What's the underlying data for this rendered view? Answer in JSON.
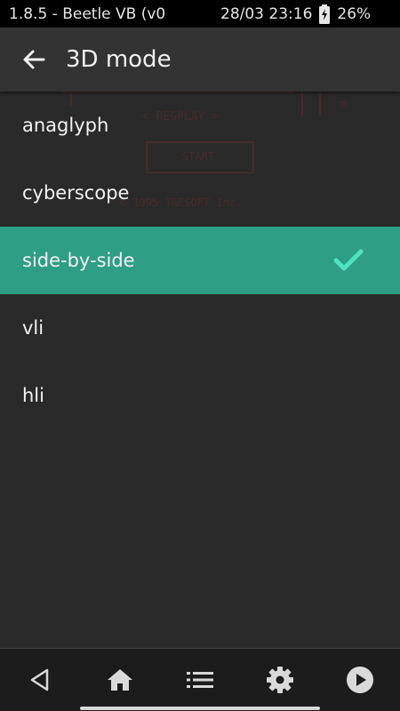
{
  "status_bar": {
    "app_title": "1.8.5 - Beetle VB (v0",
    "datetime": "28/03 23:16",
    "battery_percent": "26%",
    "battery_icon": "battery-charging-icon"
  },
  "header": {
    "back_icon": "arrow-left-icon",
    "title": "3D mode"
  },
  "options": [
    {
      "label": "anaglyph",
      "selected": false
    },
    {
      "label": "cyberscope",
      "selected": false
    },
    {
      "label": "side-by-side",
      "selected": true
    },
    {
      "label": "vli",
      "selected": false
    },
    {
      "label": "hli",
      "selected": false
    }
  ],
  "background_game": {
    "menu_text": "< REGPLAY >",
    "start_text": "START",
    "copyright": "© 1995 T&ESOFT Inc.",
    "tm": "TM"
  },
  "bottom_nav": {
    "items": [
      "back-triangle-icon",
      "home-icon",
      "list-icon",
      "gear-icon",
      "play-circle-icon"
    ]
  },
  "colors": {
    "selected_bg": "#2e9e85",
    "check": "#4fe3c0",
    "background": "#2a2a2a",
    "header": "#333333",
    "game_ghost": "#c0392b"
  }
}
